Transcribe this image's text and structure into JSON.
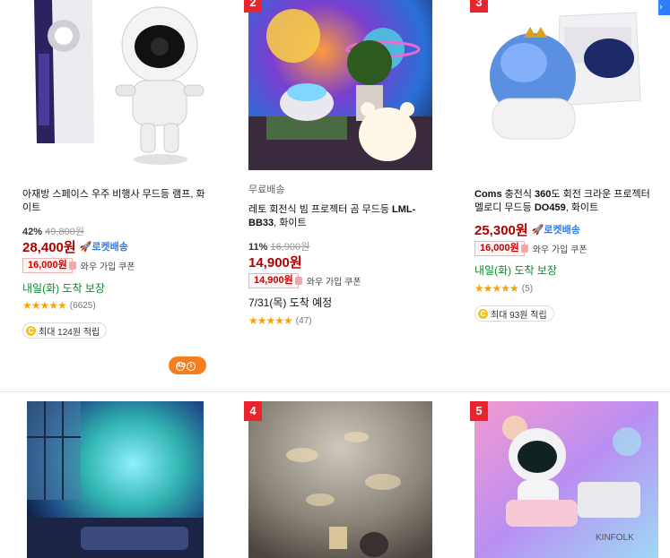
{
  "edge_button_icon": "chevron-right-icon",
  "products": [
    {
      "rank": "",
      "free_shipping": "",
      "title_plain": "아재방 스페이스 우주 비행사 무드등 램프, 화이트",
      "discount": "42%",
      "original_price": "49,800원",
      "price": "28,400원",
      "rocket": "🚀로켓배송",
      "coupon_amount": "16,000원",
      "coupon_label": "와우 가입 쿠폰",
      "delivery": "내일(화) 도착 보장",
      "stars": "★★★★★",
      "review_count": "(6625)",
      "reward": "최대 124원 적립",
      "image_icon": "astronaut-projector-image"
    },
    {
      "rank": "2",
      "free_shipping": "무료배송",
      "title_plain": "레토 회전식 빔 프로젝터 곰 무드등 ",
      "title_bold": "LML-BB33",
      "title_tail": ", 화이트",
      "discount": "11%",
      "original_price": "16,900원",
      "price": "14,900원",
      "coupon_amount": "14,900원",
      "coupon_label": "와우 가입 쿠폰",
      "delivery": "7/31(목) 도착 예정",
      "stars": "★★★★★",
      "review_count": "(47)",
      "image_icon": "bear-projector-image"
    },
    {
      "rank": "3",
      "free_shipping": "",
      "title_bold_prefix": "Coms",
      "title_plain": " 충전식 ",
      "title_bold": "360",
      "title_mid": "도 회전 크라운 프로젝터 멜로디 무드등 ",
      "title_bold2": "DO459",
      "title_tail": ", 화이트",
      "price": "25,300원",
      "rocket": "🚀로켓배송",
      "coupon_amount": "16,000원",
      "coupon_label": "와우 가입 쿠폰",
      "delivery": "내일(화) 도착 보장",
      "stars": "★★★★★",
      "review_count": "(5)",
      "reward": "최대 93원 적립",
      "image_icon": "crown-projector-image"
    },
    {
      "rank": "",
      "image_icon": "galaxy-room-image"
    },
    {
      "rank": "4",
      "image_icon": "ocean-projector-image"
    },
    {
      "rank": "5",
      "image_icon": "astronaut-pink-image"
    }
  ],
  "ad": {
    "label": "AD",
    "icon": "info-icon"
  }
}
